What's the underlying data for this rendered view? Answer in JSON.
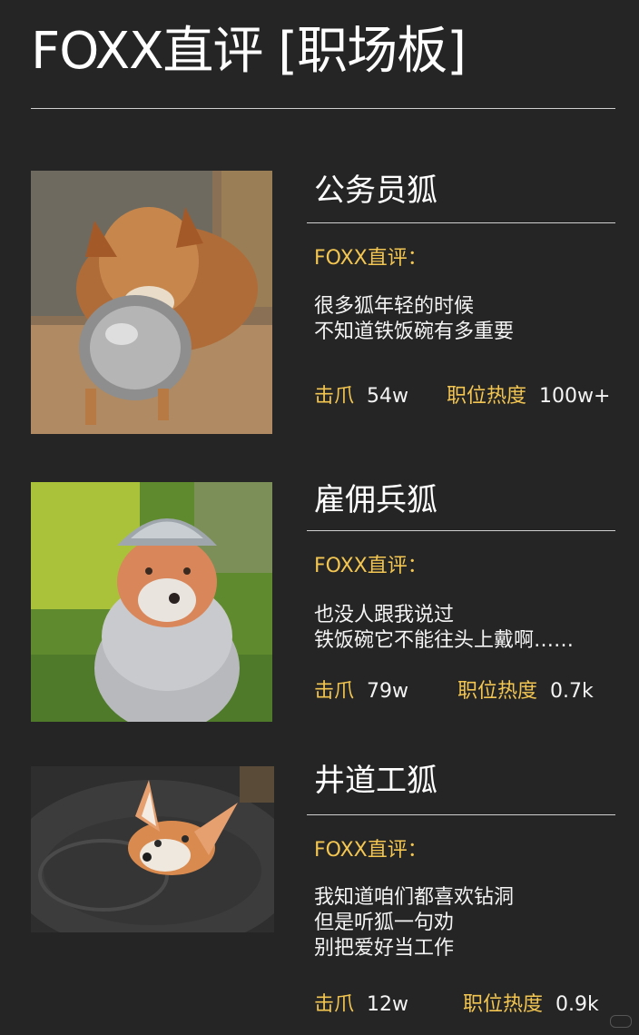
{
  "page": {
    "title": "FOXX直评 [职场板]"
  },
  "cards": [
    {
      "job": "公务员狐",
      "review_label": "FOXX直评：",
      "review_lines": [
        "很多狐年轻的时候",
        "不知道铁饭碗有多重要"
      ],
      "stat1_label": "击爪",
      "stat1_value": "54w",
      "stat2_label": "职位热度",
      "stat2_value": "100w+",
      "photo_subject": "fox-with-bowl-photo"
    },
    {
      "job": "雇佣兵狐",
      "review_label": "FOXX直评：",
      "review_lines": [
        "也没人跟我说过",
        "铁饭碗它不能往头上戴啊……"
      ],
      "stat1_label": "击爪",
      "stat1_value": "79w",
      "stat2_label": "职位热度",
      "stat2_value": "0.7k",
      "photo_subject": "fox-wearing-bowl-photo"
    },
    {
      "job": "井道工狐",
      "review_label": "FOXX直评：",
      "review_lines": [
        "我知道咱们都喜欢钻洞",
        "但是听狐一句劝",
        "别把爱好当工作"
      ],
      "stat1_label": "击爪",
      "stat1_value": "12w",
      "stat2_label": "职位热度",
      "stat2_value": "0.9k",
      "photo_subject": "fox-in-hole-photo"
    }
  ],
  "colors": {
    "background": "#252525",
    "accent": "#f3c652",
    "text": "#ffffff"
  }
}
